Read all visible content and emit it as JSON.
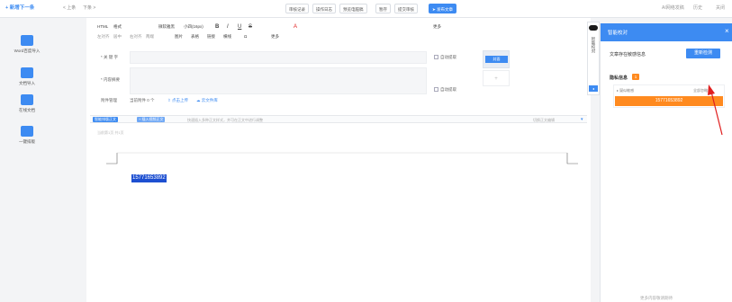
{
  "topbar": {
    "new_next": "+ 新增下一条",
    "prev": "< 上条",
    "next": "下条 >",
    "buttons": [
      "审核记录",
      "操作日志",
      "预览电脑稿",
      "暂存",
      "提交审核"
    ],
    "publish": "发布文章",
    "right_links": [
      "AI网络发稿",
      "历史",
      "关闭"
    ]
  },
  "leftrail": {
    "items": [
      {
        "label": "",
        "icon": "cloud-icon"
      },
      {
        "label": "Word百度导入",
        "icon": "document-icon"
      },
      {
        "label": "文档导入",
        "icon": "import-icon"
      },
      {
        "label": "在线文档",
        "icon": "online-doc-icon"
      },
      {
        "label": "一键排版",
        "icon": "layout-icon"
      }
    ]
  },
  "toolbar": {
    "row1": [
      "HTML",
      "格式",
      "微软雅黑",
      "小四(16px)",
      "B",
      "I",
      "U",
      "S",
      "A",
      "更多"
    ],
    "row2": [
      "左对齐",
      "居中",
      "右对齐",
      "两端",
      "图片",
      "表格",
      "链接",
      "横线",
      "Ω",
      "更多"
    ]
  },
  "form": {
    "keyword_label": "* 关 键 字",
    "summary_label": "* 内容摘要",
    "auto_extract_1": "自动提取",
    "auto_extract_2": "自动提取",
    "cover_label": "封面",
    "attachment_label": "附件管理",
    "attachment_count": "当前附件 0 个",
    "local_upload": "点击上传",
    "cloud_upload": "云文件库",
    "side_tab": "智能校对"
  },
  "divider": {
    "btn1": "智能排版正文",
    "btn2": "+ 插入视频正文",
    "hint": "快速插入多种正文样式，并可在正文中进行调整",
    "right": "切换正文编辑"
  },
  "page": {
    "meta": "当前第1页 共1页",
    "highlight_text": "15771653892"
  },
  "panel": {
    "title": "智能校对",
    "close": "×",
    "summary_text": "文章存在敏感信息",
    "recheck_button": "重新检测",
    "category_label": "隐私信息",
    "category_count": "1",
    "item_type": "疑似敏感",
    "item_action": "全部忽略",
    "item_value": "15771653892",
    "footer": "更多内容敬请期待"
  },
  "colors": {
    "primary": "#3d8bf2",
    "accent_orange": "#ff8a1f",
    "arrow_red": "#e02020",
    "highlight_bg": "#1d4fd1"
  }
}
